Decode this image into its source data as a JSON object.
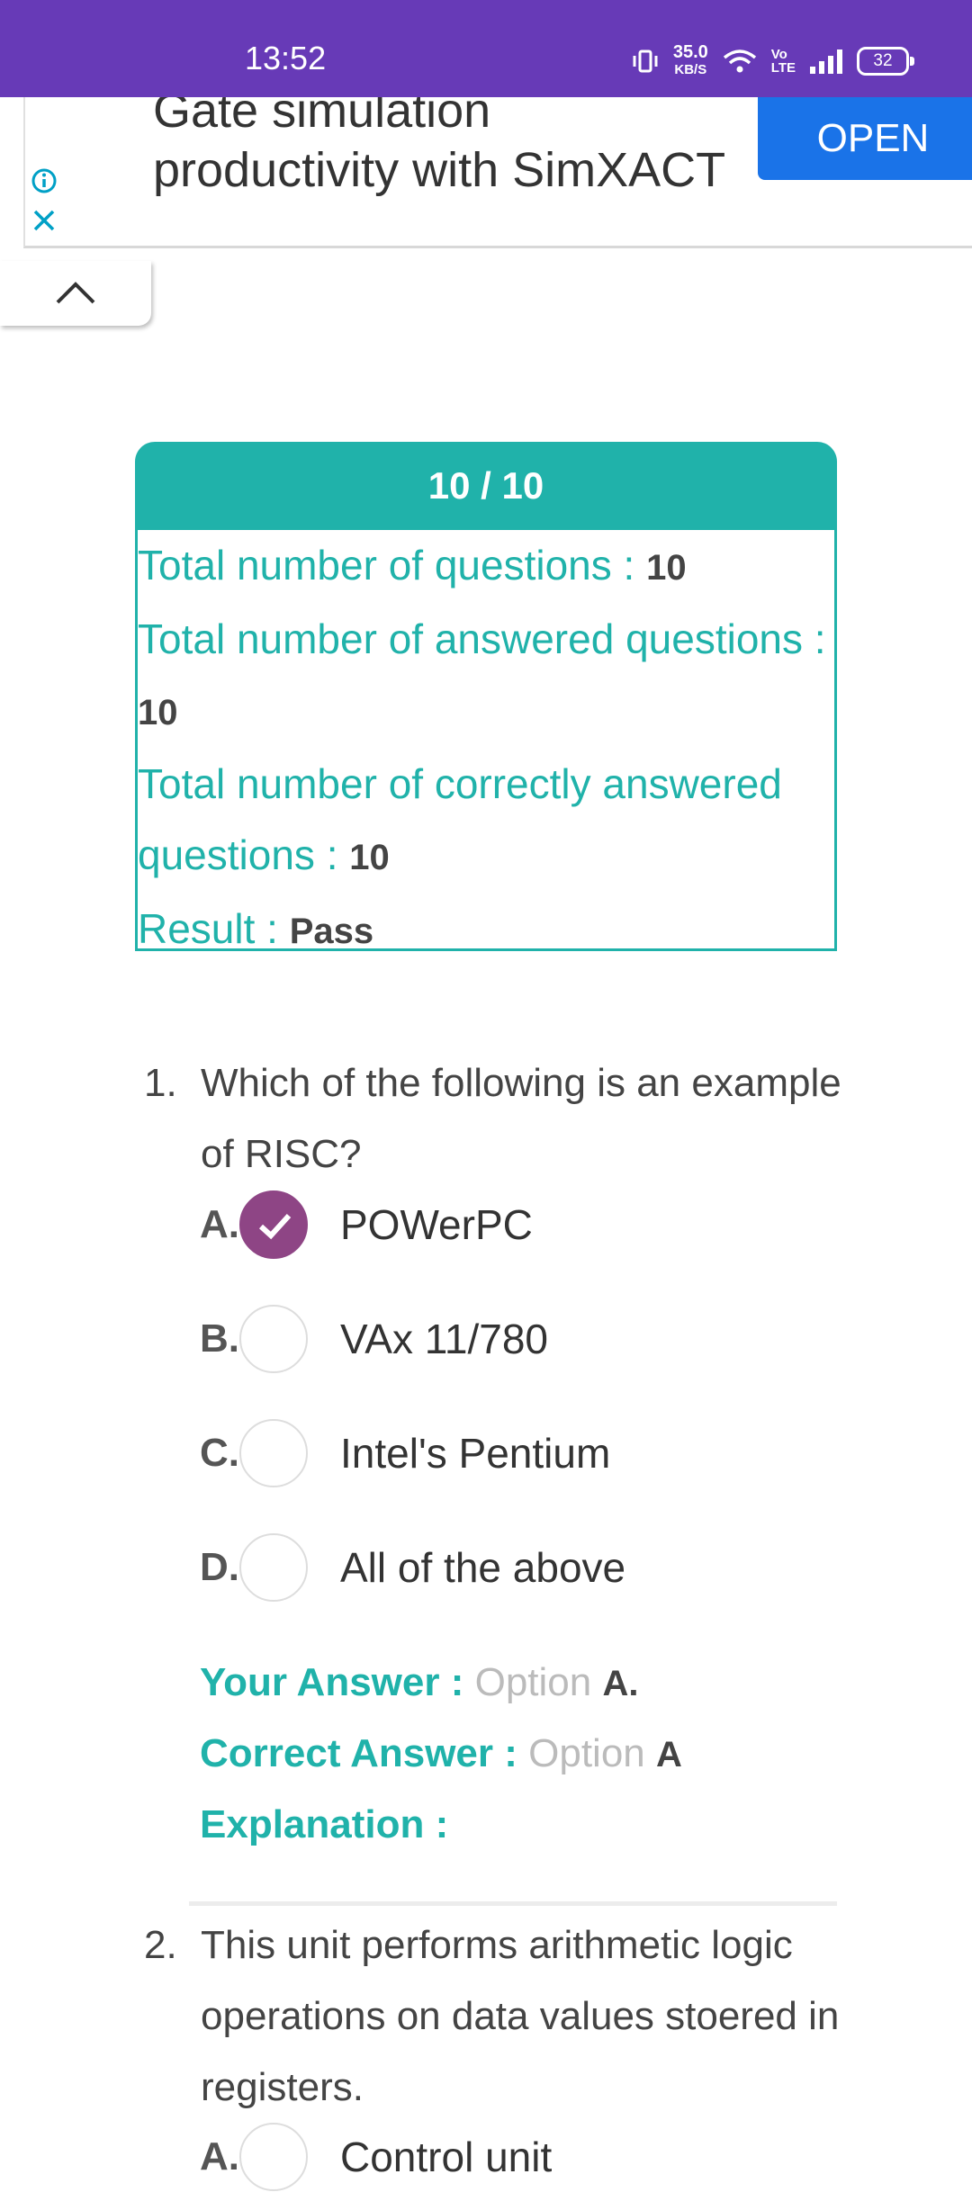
{
  "status_bar": {
    "time": "13:52",
    "net_speed_value": "35.0",
    "net_speed_unit": "KB/S",
    "volte_top": "Vo",
    "volte_bottom": "LTE",
    "battery": "32"
  },
  "ad": {
    "headline_line1": "Gate simulation",
    "headline_line2": "productivity with SimXACT",
    "open_label": "OPEN"
  },
  "result": {
    "score": "10 / 10",
    "total_questions_label": "Total number of questions : ",
    "total_questions_value": "10",
    "answered_label": "Total number of answered questions : ",
    "answered_value": "10",
    "correct_label": "Total number of correctly answered questions : ",
    "correct_value": "10",
    "result_label": "Result : ",
    "result_value": "Pass"
  },
  "questions": [
    {
      "number": "1.",
      "text": "Which of the following is an example of RISC?",
      "options": [
        {
          "letter": "A.",
          "text": "POWerPC",
          "selected": true
        },
        {
          "letter": "B.",
          "text": "VAx 11/780",
          "selected": false
        },
        {
          "letter": "C.",
          "text": "Intel's Pentium",
          "selected": false
        },
        {
          "letter": "D.",
          "text": "All of the above",
          "selected": false
        }
      ],
      "your_answer_label": "Your Answer : ",
      "your_answer_word": "Option ",
      "your_answer_value": "A.",
      "correct_answer_label": "Correct Answer : ",
      "correct_answer_word": "Option ",
      "correct_answer_value": "A",
      "explanation_label": "Explanation :"
    },
    {
      "number": "2.",
      "text": "This unit performs arithmetic logic operations on data values stoered in registers.",
      "options": [
        {
          "letter": "A.",
          "text": "Control unit",
          "selected": false
        }
      ]
    }
  ]
}
